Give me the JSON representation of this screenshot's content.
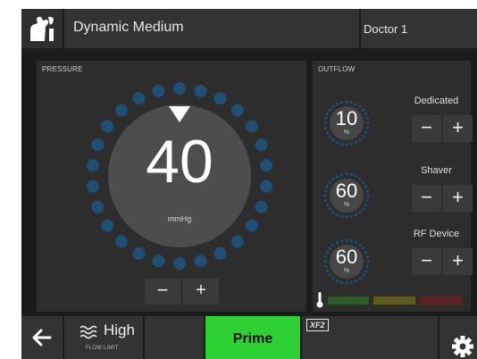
{
  "header": {
    "mode": "Dynamic Medium",
    "doctor": "Doctor 1",
    "logo_icon": "knee-joint-icon"
  },
  "pressure": {
    "title": "PRESSURE",
    "value": "40",
    "unit": "mmHg",
    "minus_label": "−",
    "plus_label": "+",
    "indicator_icon": "triangle-down-icon"
  },
  "outflow": {
    "title": "OUTFLOW",
    "devices": [
      {
        "label": "Dedicated",
        "value": "10",
        "unit": "%"
      },
      {
        "label": "Shaver",
        "value": "60",
        "unit": "%"
      },
      {
        "label": "RF Device",
        "value": "60",
        "unit": "%"
      }
    ],
    "minus_label": "−",
    "plus_label": "+",
    "temperature_icon": "thermometer-icon",
    "temperature_colors": [
      "#2e5a2a",
      "#5f5a1e",
      "#5a2424"
    ]
  },
  "footer": {
    "back_icon": "arrow-left-icon",
    "flow_icon": "waves-icon",
    "flow_value": "High",
    "flow_label": "FLOW LIMIT",
    "prime_label": "Prime",
    "badge": "XF2",
    "settings_icon": "gear-icon"
  },
  "colors": {
    "background": "#1b1b1b",
    "panel": "#2d2d2d",
    "dot": "#1f4f73",
    "prime": "#2ed134"
  }
}
